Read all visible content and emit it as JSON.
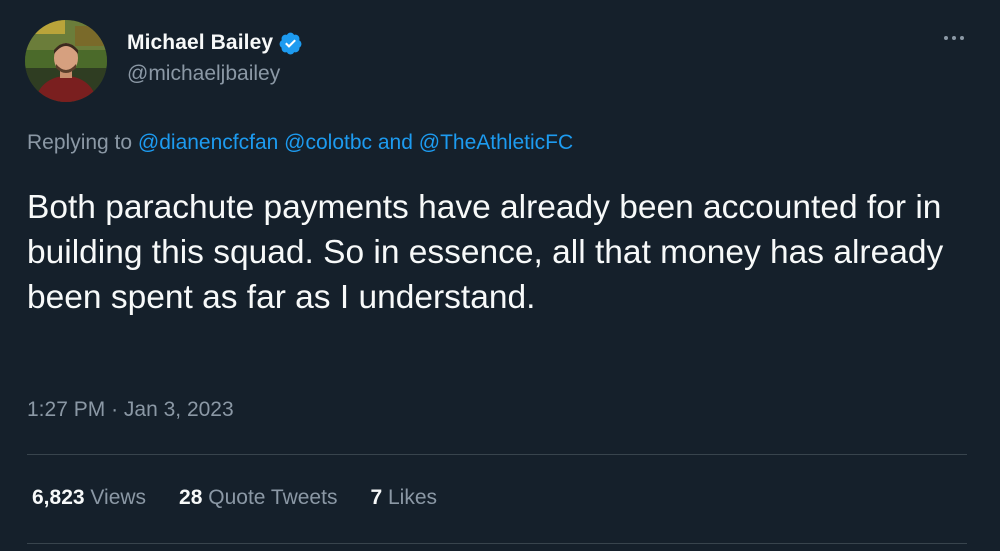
{
  "author": {
    "display_name": "Michael Bailey",
    "handle": "@michaeljbailey",
    "verified": true,
    "avatar_icon": "profile-photo"
  },
  "more_icon": "more-options-icon",
  "reply": {
    "prefix": "Replying to",
    "mention_1": "@dianencfcfan",
    "mention_2": "@colotbc",
    "conjunction": "and",
    "mention_3": "@TheAthleticFC"
  },
  "tweet_text": "Both parachute payments have already been accounted for in building this squad. So in essence, all that money has already been spent as far as I understand.",
  "time": "1:27 PM",
  "separator": "·",
  "date": "Jan 3, 2023",
  "stats": {
    "views_count": "6,823",
    "views_label": "Views",
    "quotes_count": "28",
    "quotes_label": "Quote Tweets",
    "likes_count": "7",
    "likes_label": "Likes"
  },
  "colors": {
    "background": "#15202b",
    "text": "#f7f9f9",
    "secondary": "#8b98a5",
    "link": "#1d9bf0",
    "divider": "#38444d"
  }
}
